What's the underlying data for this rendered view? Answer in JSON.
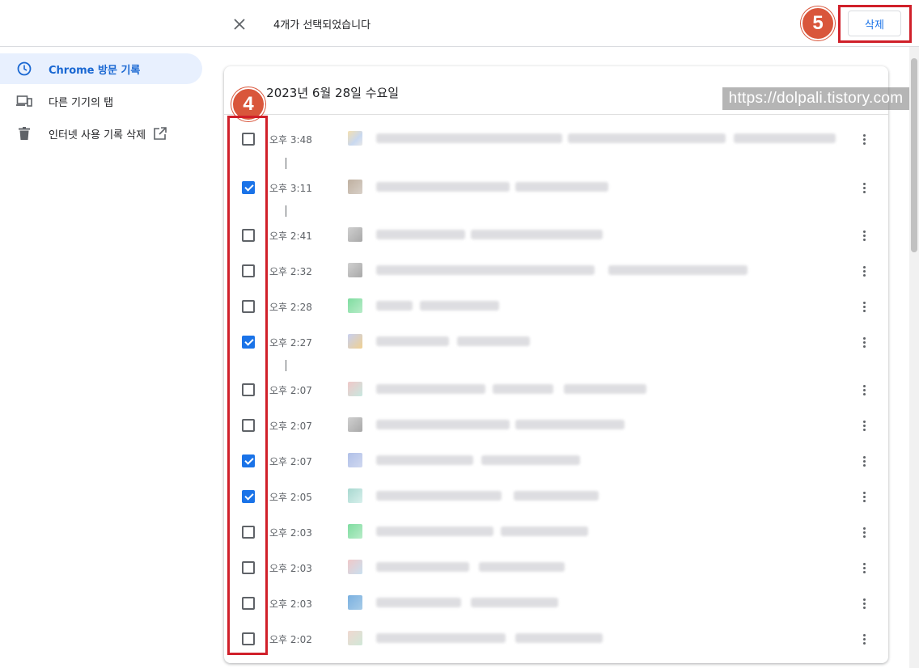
{
  "topbar": {
    "selected_text": "4개가 선택되었습니다",
    "delete_label": "삭제"
  },
  "annotations": {
    "badge_delete": "5",
    "badge_checkboxes": "4"
  },
  "sidebar": {
    "items": [
      {
        "label": "Chrome 방문 기록",
        "icon": "clock-icon",
        "active": true
      },
      {
        "label": "다른 기기의 탭",
        "icon": "devices-icon",
        "active": false
      },
      {
        "label": "인터넷 사용 기록 삭제",
        "icon": "trash-icon",
        "active": false
      }
    ]
  },
  "card": {
    "title": "- 2023년 6월 28일 수요일"
  },
  "watermark": "https://dolpali.tistory.com",
  "history": [
    {
      "time": "오후 3:48",
      "checked": false
    },
    {
      "time": "오후 3:11",
      "checked": true
    },
    {
      "time": "오후 2:41",
      "checked": false
    },
    {
      "time": "오후 2:32",
      "checked": false
    },
    {
      "time": "오후 2:28",
      "checked": false
    },
    {
      "time": "오후 2:27",
      "checked": true
    },
    {
      "time": "오후 2:07",
      "checked": false
    },
    {
      "time": "오후 2:07",
      "checked": false
    },
    {
      "time": "오후 2:07",
      "checked": true
    },
    {
      "time": "오후 2:05",
      "checked": true
    },
    {
      "time": "오후 2:03",
      "checked": false
    },
    {
      "time": "오후 2:03",
      "checked": false
    },
    {
      "time": "오후 2:03",
      "checked": false
    },
    {
      "time": "오후 2:02",
      "checked": false
    }
  ],
  "colors": {
    "accent": "#1a73e8",
    "highlight": "#d0202a",
    "badge": "#d9563b"
  }
}
